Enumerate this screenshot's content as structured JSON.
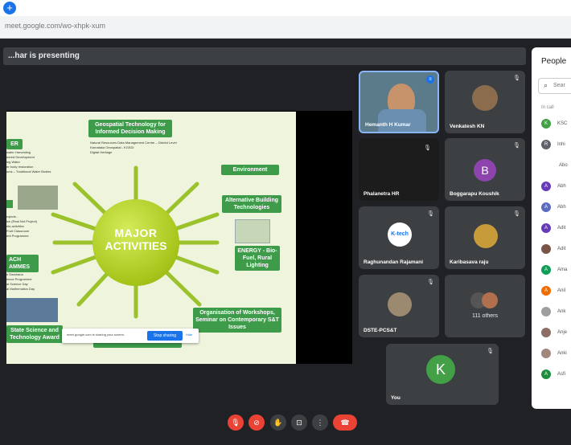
{
  "browser": {
    "url": "meet.google.com/wo-xhpk-xum",
    "logo": "+"
  },
  "presenting_banner": "...har is presenting",
  "slide": {
    "title_top": "Geospatial Technology for Informed Decision Making",
    "top_bullets": [
      "Natural Resources Data Management Centre – District Level",
      "Karnataka Geospatial - KGSDI",
      "Digital Heritage"
    ],
    "center_line1": "MAJOR",
    "center_line2": "ACTIVITIES",
    "environment": "Environment",
    "alt_building": "Alternative Building Technologies",
    "energy": "ENERGY - Bio-Fuel, Rural Lighting",
    "workshops": "Organisation of Workshops, Seminar on Contemporary S&T Issues",
    "water_box": "ER",
    "water_bullets": [
      "water Harvesting",
      "nered Development",
      "ing Water",
      "er body restoration",
      "ums – Traditional Water Bodies"
    ],
    "projects_bullets": [
      "rojects -",
      "ice (Real Not Project)",
      "nts activities",
      "Fruit Classroom",
      "ent Programme"
    ],
    "outreach_box": "ACH\nAMMES",
    "outreach_bullets": [
      "n Darshana",
      "ience Programme",
      "al Science Day",
      "al Mathematics Day"
    ],
    "state_science": "State Science and Technology Award"
  },
  "share_notice": {
    "message": "meet.google.com is sharing your screen.",
    "stop": "Stop sharing",
    "hide": "Hide"
  },
  "tiles": [
    {
      "name": "Hemanth H Kumar"
    },
    {
      "name": "Venkatesh KN"
    },
    {
      "name": "Phalanetra HR"
    },
    {
      "name": "Boggarapu Koushik",
      "initial": "B"
    },
    {
      "name": "Raghunandan Rajamani",
      "badge": "K-tech"
    },
    {
      "name": "Karibasava raju"
    },
    {
      "name": "DSTE-PCS&T"
    },
    {
      "name": "111 others"
    },
    {
      "name": "You",
      "initial": "K"
    }
  ],
  "people": {
    "title": "People",
    "search_placeholder": "Sear",
    "section": "In call",
    "items": [
      {
        "label": "KSC",
        "initial": "K",
        "color": "#43a047"
      },
      {
        "label": "Inhi",
        "initial": "R",
        "color": "#5f6368"
      },
      {
        "label": "Abo",
        "initial": "",
        "color": ""
      },
      {
        "label": "Abh",
        "initial": "A",
        "color": "#673ab7"
      },
      {
        "label": "Abh",
        "initial": "A",
        "color": "#5c6bc0"
      },
      {
        "label": "Adit",
        "initial": "A",
        "color": "#673ab7"
      },
      {
        "label": "Adit",
        "initial": "",
        "color": "#795548"
      },
      {
        "label": "Ama",
        "initial": "A",
        "color": "#0f9d58"
      },
      {
        "label": "Anil",
        "initial": "A",
        "color": "#ef6c00"
      },
      {
        "label": "Ank",
        "initial": "",
        "color": "#9e9e9e"
      },
      {
        "label": "Anje",
        "initial": "",
        "color": "#8d6e63"
      },
      {
        "label": "Anki",
        "initial": "",
        "color": "#a1887f"
      },
      {
        "label": "Asfi",
        "initial": "A",
        "color": "#1e8e3e"
      }
    ]
  },
  "colors": {
    "meet_bg": "#202124",
    "tile_bg": "#3c4043",
    "red": "#ea4335",
    "slide_green": "#3d9b4a"
  }
}
